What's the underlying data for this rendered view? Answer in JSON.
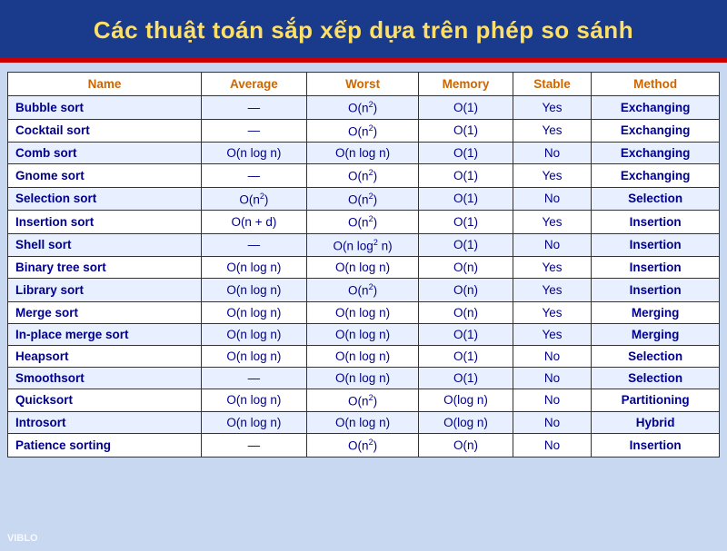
{
  "header": {
    "title": "Các thuật toán sắp xếp dựa trên phép so sánh"
  },
  "table": {
    "columns": [
      "Name",
      "Average",
      "Worst",
      "Memory",
      "Stable",
      "Method"
    ],
    "rows": [
      {
        "name": "Bubble sort",
        "average": "—",
        "worst": "O(n²)",
        "memory": "O(1)",
        "stable": "Yes",
        "method": "Exchanging"
      },
      {
        "name": "Cocktail sort",
        "average": "—",
        "worst": "O(n²)",
        "memory": "O(1)",
        "stable": "Yes",
        "method": "Exchanging"
      },
      {
        "name": "Comb sort",
        "average": "O(n log n)",
        "worst": "O(n log n)",
        "memory": "O(1)",
        "stable": "No",
        "method": "Exchanging"
      },
      {
        "name": "Gnome sort",
        "average": "—",
        "worst": "O(n²)",
        "memory": "O(1)",
        "stable": "Yes",
        "method": "Exchanging"
      },
      {
        "name": "Selection sort",
        "average": "O(n²)",
        "worst": "O(n²)",
        "memory": "O(1)",
        "stable": "No",
        "method": "Selection"
      },
      {
        "name": "Insertion sort",
        "average": "O(n + d)",
        "worst": "O(n²)",
        "memory": "O(1)",
        "stable": "Yes",
        "method": "Insertion"
      },
      {
        "name": "Shell sort",
        "average": "—",
        "worst": "O(n log² n)",
        "memory": "O(1)",
        "stable": "No",
        "method": "Insertion"
      },
      {
        "name": "Binary tree sort",
        "average": "O(n log n)",
        "worst": "O(n log n)",
        "memory": "O(n)",
        "stable": "Yes",
        "method": "Insertion"
      },
      {
        "name": "Library sort",
        "average": "O(n log n)",
        "worst": "O(n²)",
        "memory": "O(n)",
        "stable": "Yes",
        "method": "Insertion"
      },
      {
        "name": "Merge sort",
        "average": "O(n log n)",
        "worst": "O(n log n)",
        "memory": "O(n)",
        "stable": "Yes",
        "method": "Merging"
      },
      {
        "name": "In-place merge sort",
        "average": "O(n log n)",
        "worst": "O(n log n)",
        "memory": "O(1)",
        "stable": "Yes",
        "method": "Merging"
      },
      {
        "name": "Heapsort",
        "average": "O(n log n)",
        "worst": "O(n log n)",
        "memory": "O(1)",
        "stable": "No",
        "method": "Selection"
      },
      {
        "name": "Smoothsort",
        "average": "—",
        "worst": "O(n log n)",
        "memory": "O(1)",
        "stable": "No",
        "method": "Selection"
      },
      {
        "name": "Quicksort",
        "average": "O(n log n)",
        "worst": "O(n²)",
        "memory": "O(log n)",
        "stable": "No",
        "method": "Partitioning"
      },
      {
        "name": "Introsort",
        "average": "O(n log n)",
        "worst": "O(n log n)",
        "memory": "O(log n)",
        "stable": "No",
        "method": "Hybrid"
      },
      {
        "name": "Patience sorting",
        "average": "—",
        "worst": "O(n²)",
        "memory": "O(n)",
        "stable": "No",
        "method": "Insertion"
      }
    ]
  },
  "watermark": "VIBLO"
}
